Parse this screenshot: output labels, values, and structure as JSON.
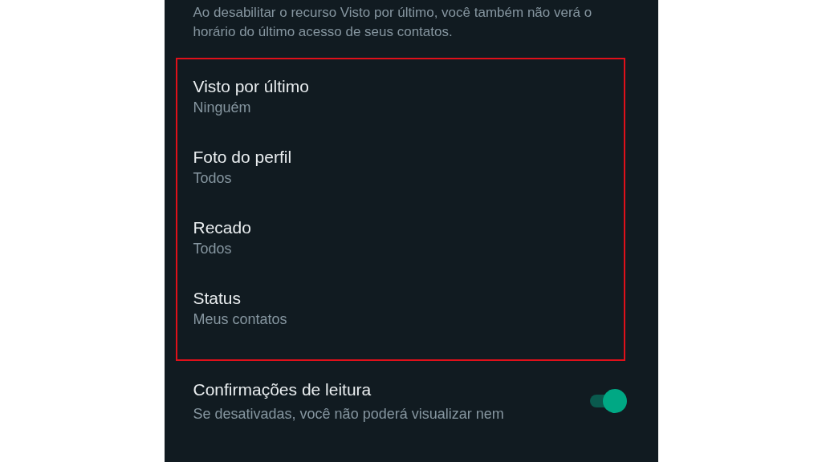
{
  "description": "Ao desabilitar o recurso Visto por último, você também não verá o horário do último acesso de seus contatos.",
  "highlighted_settings": [
    {
      "title": "Visto por último",
      "value": "Ninguém"
    },
    {
      "title": "Foto do perfil",
      "value": "Todos"
    },
    {
      "title": "Recado",
      "value": "Todos"
    },
    {
      "title": "Status",
      "value": "Meus contatos"
    }
  ],
  "read_receipts": {
    "title": "Confirmações de leitura",
    "on": true,
    "description": "Se desativadas, você não poderá visualizar nem"
  }
}
